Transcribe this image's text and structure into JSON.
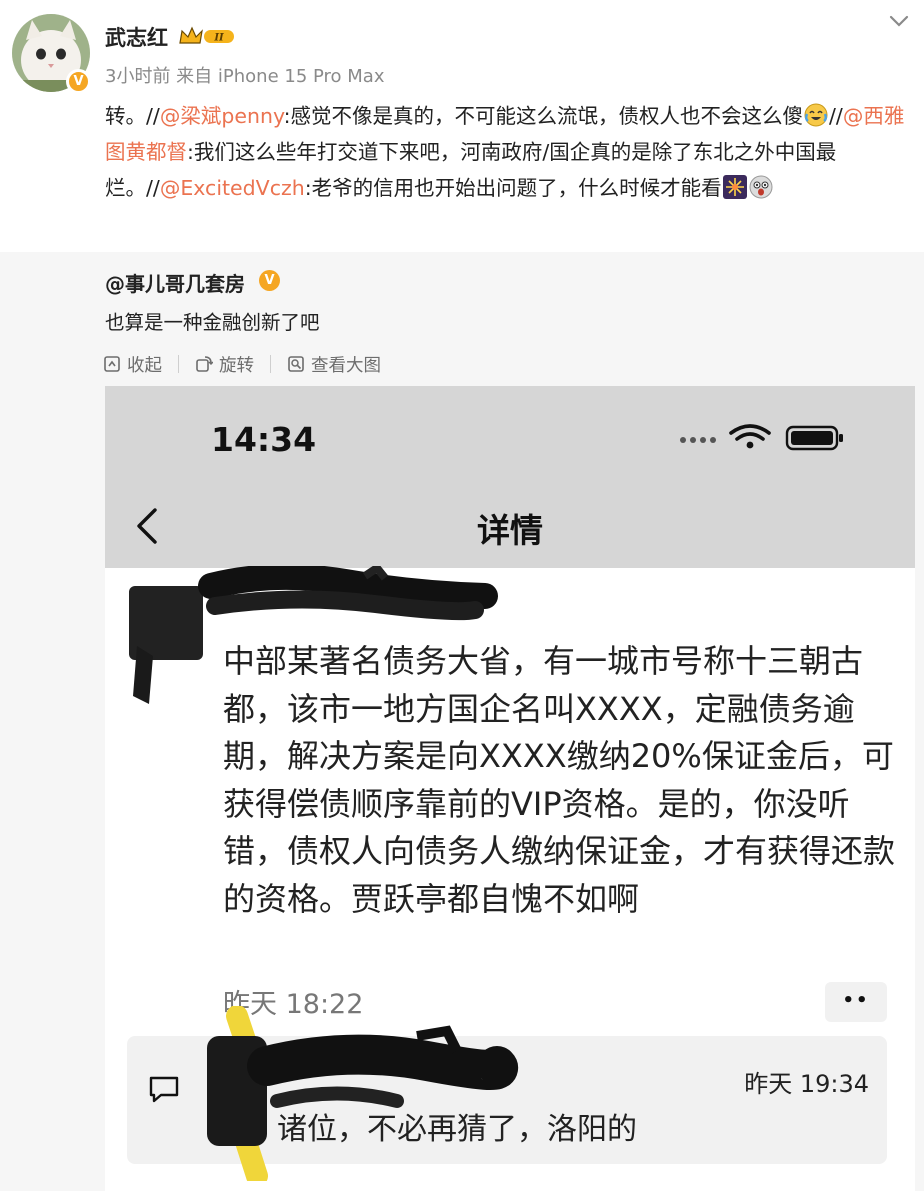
{
  "post": {
    "username": "武志红",
    "meta": "3小时前 来自 iPhone 15 Pro Max",
    "segments": [
      {
        "text": "转。//",
        "mention": false
      },
      {
        "text": "@梁斌penny",
        "mention": true
      },
      {
        "text": ":感觉不像是真的，不可能这么流氓，债权人也不会这么傻",
        "mention": false
      },
      {
        "emoji": "crying-laugh-emoji"
      },
      {
        "text": "//",
        "mention": false
      },
      {
        "text": "@西雅图黄都督",
        "mention": true
      },
      {
        "text": ":我们这么些年打交道下来吧，河南政府/国企真的是除了东北之外中国最烂。//",
        "mention": false
      },
      {
        "text": "@ExcitedVczh",
        "mention": true
      },
      {
        "text": ":老爷的信用也开始出问题了，什么时候才能看",
        "mention": false
      },
      {
        "emoji": "fireworks-emoji"
      },
      {
        "emoji": "shocked-face-emoji"
      }
    ]
  },
  "quote": {
    "username": "@事儿哥几套房",
    "text": "也算是一种金融创新了吧",
    "tools": [
      {
        "label": "收起",
        "icon": "collapse-icon"
      },
      {
        "label": "旋转",
        "icon": "rotate-icon"
      },
      {
        "label": "查看大图",
        "icon": "view-large-icon"
      }
    ]
  },
  "screenshot": {
    "clock": "14:34",
    "title": "详情",
    "body": "中部某著名债务大省，有一城市号称十三朝古都，该市一地方国企名叫XXXX，定融债务逾期，解决方案是向XXXX缴纳20%保证金后，可获得偿债顺序靠前的VIP资格。是的，你没听错，债权人向债务人缴纳保证金，才有获得还款的资格。贾跃亭都自愧不如啊",
    "time": "昨天 18:22",
    "more": "••",
    "reply": {
      "time": "昨天 19:34",
      "text": "诸位，不必再猜了，洛阳的"
    }
  },
  "colors": {
    "mention": "#eb7350",
    "badge": "#f5a623",
    "quote_bg": "#f6f6f6",
    "phone_header_bg": "#d6d6d6"
  }
}
